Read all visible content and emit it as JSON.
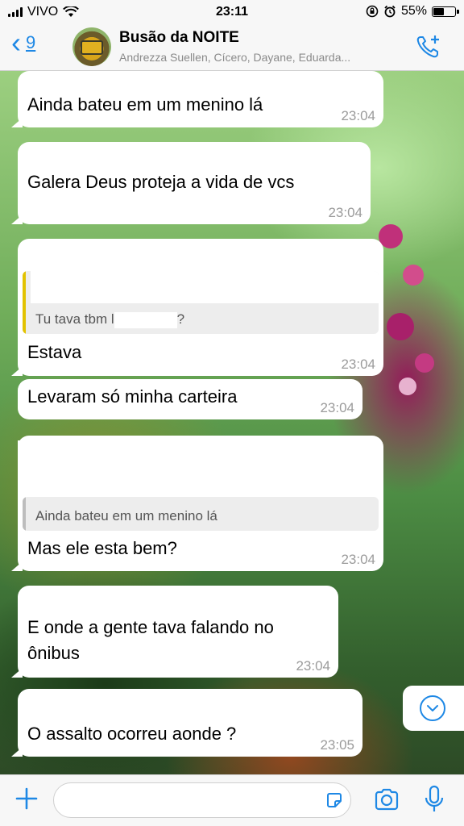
{
  "status_bar": {
    "carrier": "VIVO",
    "time": "23:11",
    "battery_percent": "55%",
    "battery_level": 0.55,
    "icons": [
      "signal-icon",
      "wifi-icon",
      "lock-rotation-icon",
      "alarm-icon",
      "battery-icon"
    ]
  },
  "header": {
    "back_count": "9",
    "title": "Busão da NOITE",
    "subtitle": "Andrezza Suellen, Cícero, Dayane, Eduarda...",
    "icons": [
      "back-chevron-icon",
      "group-avatar",
      "add-call-icon"
    ],
    "accent_color": "#1e88e5"
  },
  "messages": [
    {
      "text": "Ainda bateu em um menino lá",
      "time": "23:04"
    },
    {
      "text": "Galera Deus proteja a vida de vcs",
      "time": "23:04"
    },
    {
      "quote": "Tu tava tbm l",
      "quote_suffix": "?",
      "text": "Estava",
      "time": "23:04"
    },
    {
      "text": "Levaram só minha carteira",
      "time": "23:04"
    },
    {
      "quote": "Ainda bateu em um menino lá",
      "text": "Mas ele esta bem?",
      "time": "23:04"
    },
    {
      "text_line1": "E onde a gente tava falando no",
      "text_line2": "ônibus",
      "time": "23:04"
    },
    {
      "text": "O assalto ocorreu aonde ?",
      "time": "23:05"
    }
  ],
  "input_bar": {
    "icons": [
      "plus-icon",
      "sticker-icon",
      "camera-icon",
      "microphone-icon"
    ],
    "message_value": ""
  },
  "colors": {
    "bubble": "#ffffff",
    "quote_bar_yellow": "#e2c200",
    "quote_bar_gray": "#bdbdbd",
    "time_gray": "#9b9b9b"
  }
}
